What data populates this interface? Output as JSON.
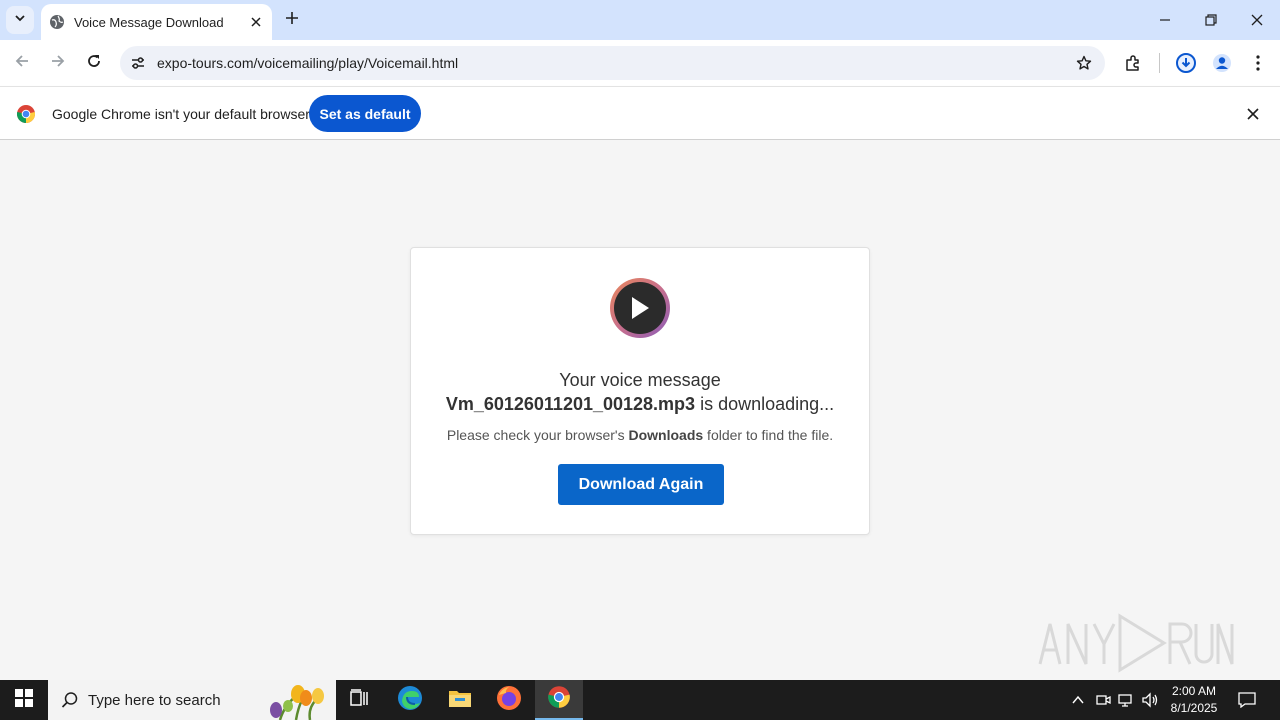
{
  "browser": {
    "tab_title": "Voice Message Download",
    "url": "expo-tours.com/voicemailing/play/Voicemail.html"
  },
  "infobar": {
    "message": "Google Chrome isn't your default browser",
    "button": "Set as default"
  },
  "page": {
    "line1": "Your voice message",
    "filename": "Vm_60126011201_00128.mp3",
    "line2_suffix": " is downloading...",
    "hint_prefix": "Please check your browser's ",
    "hint_bold": "Downloads",
    "hint_suffix": " folder to find the file.",
    "button": "Download Again"
  },
  "taskbar": {
    "search_placeholder": "Type here to search",
    "time": "2:00 AM",
    "date": "8/1/2025"
  },
  "colors": {
    "accent": "#0b57d0",
    "download_button": "#0a66c9"
  }
}
